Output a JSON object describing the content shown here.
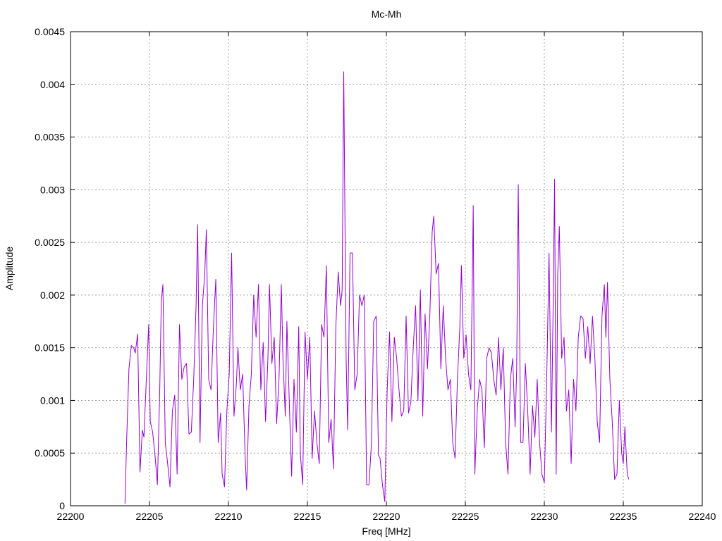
{
  "chart_data": {
    "type": "line",
    "title": "Mc-Mh",
    "xlabel": "Freq [MHz]",
    "ylabel": "Amplitude",
    "xlim": [
      22200,
      22240
    ],
    "ylim": [
      0,
      0.0045
    ],
    "grid": true,
    "x_ticks": [
      22200,
      22205,
      22210,
      22215,
      22220,
      22225,
      22230,
      22235,
      22240
    ],
    "y_ticks": [
      0,
      0.0005,
      0.001,
      0.0015,
      0.002,
      0.0025,
      0.003,
      0.0035,
      0.004,
      0.0045
    ],
    "x_tick_labels": [
      "22200",
      "22205",
      "22210",
      "22215",
      "22220",
      "22225",
      "22230",
      "22235",
      "22240"
    ],
    "y_tick_labels": [
      "0",
      "0.0005",
      "0.001",
      "0.0015",
      "0.002",
      "0.0025",
      "0.003",
      "0.0035",
      "0.004",
      "0.0045"
    ],
    "series": [
      {
        "color": "#9400d3",
        "points": [
          [
            22203.45,
            2e-05
          ],
          [
            22203.55,
            0.0006
          ],
          [
            22203.7,
            0.0013
          ],
          [
            22203.85,
            0.00152
          ],
          [
            22204.0,
            0.0015
          ],
          [
            22204.1,
            0.00145
          ],
          [
            22204.25,
            0.00163
          ],
          [
            22204.4,
            0.00032
          ],
          [
            22204.55,
            0.00072
          ],
          [
            22204.65,
            0.00065
          ],
          [
            22204.8,
            0.0012
          ],
          [
            22204.95,
            0.00172
          ],
          [
            22205.05,
            0.0008
          ],
          [
            22205.2,
            0.0007
          ],
          [
            22205.35,
            0.00048
          ],
          [
            22205.5,
            0.0002
          ],
          [
            22205.65,
            0.0011
          ],
          [
            22205.75,
            0.00195
          ],
          [
            22205.85,
            0.0021
          ],
          [
            22206.0,
            0.0006
          ],
          [
            22206.15,
            0.0004
          ],
          [
            22206.3,
            0.00018
          ],
          [
            22206.45,
            0.0009
          ],
          [
            22206.6,
            0.00105
          ],
          [
            22206.75,
            0.0003
          ],
          [
            22206.9,
            0.00172
          ],
          [
            22207.05,
            0.0012
          ],
          [
            22207.2,
            0.00132
          ],
          [
            22207.35,
            0.00135
          ],
          [
            22207.5,
            0.00068
          ],
          [
            22207.65,
            0.0007
          ],
          [
            22207.8,
            0.0012
          ],
          [
            22207.95,
            0.0019
          ],
          [
            22208.05,
            0.00267
          ],
          [
            22208.2,
            0.0006
          ],
          [
            22208.35,
            0.0019
          ],
          [
            22208.5,
            0.0022
          ],
          [
            22208.6,
            0.00262
          ],
          [
            22208.75,
            0.0012
          ],
          [
            22208.9,
            0.0011
          ],
          [
            22209.05,
            0.0017
          ],
          [
            22209.2,
            0.00215
          ],
          [
            22209.35,
            0.0006
          ],
          [
            22209.5,
            0.00088
          ],
          [
            22209.6,
            0.0003
          ],
          [
            22209.75,
            0.00018
          ],
          [
            22209.9,
            0.0009
          ],
          [
            22210.05,
            0.00125
          ],
          [
            22210.2,
            0.0024
          ],
          [
            22210.35,
            0.00085
          ],
          [
            22210.5,
            0.00115
          ],
          [
            22210.6,
            0.0015
          ],
          [
            22210.75,
            0.0011
          ],
          [
            22210.9,
            0.00125
          ],
          [
            22211.05,
            0.0005
          ],
          [
            22211.15,
            0.00015
          ],
          [
            22211.3,
            0.00095
          ],
          [
            22211.45,
            0.00125
          ],
          [
            22211.6,
            0.002
          ],
          [
            22211.75,
            0.0016
          ],
          [
            22211.9,
            0.0021
          ],
          [
            22212.05,
            0.0011
          ],
          [
            22212.2,
            0.00155
          ],
          [
            22212.35,
            0.0008
          ],
          [
            22212.5,
            0.0014
          ],
          [
            22212.6,
            0.0021
          ],
          [
            22212.75,
            0.00135
          ],
          [
            22212.9,
            0.0016
          ],
          [
            22213.05,
            0.00078
          ],
          [
            22213.2,
            0.0012
          ],
          [
            22213.35,
            0.0021
          ],
          [
            22213.45,
            0.0014
          ],
          [
            22213.6,
            0.00085
          ],
          [
            22213.7,
            0.00175
          ],
          [
            22213.85,
            0.001
          ],
          [
            22214.0,
            0.00028
          ],
          [
            22214.15,
            0.0012
          ],
          [
            22214.3,
            0.0007
          ],
          [
            22214.45,
            0.0017
          ],
          [
            22214.55,
            0.0005
          ],
          [
            22214.7,
            0.0002
          ],
          [
            22214.85,
            0.00165
          ],
          [
            22215.0,
            0.0012
          ],
          [
            22215.15,
            0.0016
          ],
          [
            22215.3,
            0.00045
          ],
          [
            22215.45,
            0.0009
          ],
          [
            22215.6,
            0.0006
          ],
          [
            22215.75,
            0.0004
          ],
          [
            22215.9,
            0.00172
          ],
          [
            22216.05,
            0.0016
          ],
          [
            22216.2,
            0.00228
          ],
          [
            22216.35,
            0.0006
          ],
          [
            22216.5,
            0.00082
          ],
          [
            22216.65,
            0.00035
          ],
          [
            22216.8,
            0.0017
          ],
          [
            22216.95,
            0.00222
          ],
          [
            22217.1,
            0.0019
          ],
          [
            22217.2,
            0.00205
          ],
          [
            22217.3,
            0.00412
          ],
          [
            22217.45,
            0.0014
          ],
          [
            22217.55,
            0.00072
          ],
          [
            22217.7,
            0.0024
          ],
          [
            22217.85,
            0.0024
          ],
          [
            22218.0,
            0.0011
          ],
          [
            22218.15,
            0.00125
          ],
          [
            22218.3,
            0.002
          ],
          [
            22218.45,
            0.0019
          ],
          [
            22218.6,
            0.002
          ],
          [
            22218.75,
            0.0002
          ],
          [
            22218.9,
            0.0002
          ],
          [
            22219.05,
            0.00058
          ],
          [
            22219.2,
            0.00175
          ],
          [
            22219.35,
            0.0018
          ],
          [
            22219.5,
            0.00048
          ],
          [
            22219.6,
            0.00045
          ],
          [
            22219.75,
            0.0002
          ],
          [
            22219.9,
            4e-05
          ],
          [
            22220.05,
            0.0011
          ],
          [
            22220.2,
            0.00165
          ],
          [
            22220.35,
            0.0008
          ],
          [
            22220.5,
            0.0016
          ],
          [
            22220.65,
            0.0014
          ],
          [
            22220.8,
            0.0011
          ],
          [
            22220.95,
            0.00085
          ],
          [
            22221.1,
            0.0009
          ],
          [
            22221.25,
            0.0018
          ],
          [
            22221.4,
            0.00088
          ],
          [
            22221.55,
            0.00098
          ],
          [
            22221.7,
            0.0015
          ],
          [
            22221.85,
            0.0019
          ],
          [
            22222.0,
            0.001
          ],
          [
            22222.15,
            0.00205
          ],
          [
            22222.3,
            0.00085
          ],
          [
            22222.45,
            0.00182
          ],
          [
            22222.6,
            0.0013
          ],
          [
            22222.75,
            0.0018
          ],
          [
            22222.9,
            0.0026
          ],
          [
            22223.0,
            0.00275
          ],
          [
            22223.15,
            0.0022
          ],
          [
            22223.3,
            0.0023
          ],
          [
            22223.45,
            0.0013
          ],
          [
            22223.6,
            0.0019
          ],
          [
            22223.75,
            0.0014
          ],
          [
            22223.9,
            0.0011
          ],
          [
            22224.05,
            0.0012
          ],
          [
            22224.2,
            0.0006
          ],
          [
            22224.35,
            0.00045
          ],
          [
            22224.5,
            0.0012
          ],
          [
            22224.65,
            0.0017
          ],
          [
            22224.75,
            0.00228
          ],
          [
            22224.9,
            0.0014
          ],
          [
            22225.05,
            0.00162
          ],
          [
            22225.2,
            0.00125
          ],
          [
            22225.35,
            0.0011
          ],
          [
            22225.5,
            0.00285
          ],
          [
            22225.6,
            0.0003
          ],
          [
            22225.75,
            0.0009
          ],
          [
            22225.9,
            0.0012
          ],
          [
            22226.05,
            0.0011
          ],
          [
            22226.2,
            0.00055
          ],
          [
            22226.35,
            0.0014
          ],
          [
            22226.5,
            0.0015
          ],
          [
            22226.65,
            0.00145
          ],
          [
            22226.8,
            0.0012
          ],
          [
            22226.95,
            0.00105
          ],
          [
            22227.1,
            0.0016
          ],
          [
            22227.25,
            0.0011
          ],
          [
            22227.4,
            0.0015
          ],
          [
            22227.55,
            0.0006
          ],
          [
            22227.7,
            0.0003
          ],
          [
            22227.85,
            0.0012
          ],
          [
            22228.0,
            0.0014
          ],
          [
            22228.15,
            0.00075
          ],
          [
            22228.25,
            0.0013
          ],
          [
            22228.35,
            0.00305
          ],
          [
            22228.5,
            0.0006
          ],
          [
            22228.65,
            0.0006
          ],
          [
            22228.8,
            0.00135
          ],
          [
            22228.95,
            0.0009
          ],
          [
            22229.1,
            0.0003
          ],
          [
            22229.25,
            0.00095
          ],
          [
            22229.4,
            0.00065
          ],
          [
            22229.55,
            0.0012
          ],
          [
            22229.7,
            0.0006
          ],
          [
            22229.85,
            0.0003
          ],
          [
            22230.0,
            0.00022
          ],
          [
            22230.15,
            0.0012
          ],
          [
            22230.3,
            0.0024
          ],
          [
            22230.45,
            0.0007
          ],
          [
            22230.55,
            0.0018
          ],
          [
            22230.65,
            0.0031
          ],
          [
            22230.75,
            0.0003
          ],
          [
            22230.85,
            0.0022
          ],
          [
            22230.95,
            0.00265
          ],
          [
            22231.1,
            0.0014
          ],
          [
            22231.25,
            0.0016
          ],
          [
            22231.4,
            0.0009
          ],
          [
            22231.55,
            0.0011
          ],
          [
            22231.7,
            0.0004
          ],
          [
            22231.85,
            0.0012
          ],
          [
            22232.0,
            0.0009
          ],
          [
            22232.15,
            0.0016
          ],
          [
            22232.3,
            0.0018
          ],
          [
            22232.45,
            0.00178
          ],
          [
            22232.6,
            0.0014
          ],
          [
            22232.75,
            0.0017
          ],
          [
            22232.9,
            0.00135
          ],
          [
            22233.05,
            0.0018
          ],
          [
            22233.2,
            0.0014
          ],
          [
            22233.35,
            0.0008
          ],
          [
            22233.5,
            0.0006
          ],
          [
            22233.65,
            0.0018
          ],
          [
            22233.8,
            0.0021
          ],
          [
            22233.9,
            0.0016
          ],
          [
            22234.0,
            0.00212
          ],
          [
            22234.15,
            0.0012
          ],
          [
            22234.3,
            0.0008
          ],
          [
            22234.45,
            0.00025
          ],
          [
            22234.6,
            0.0003
          ],
          [
            22234.75,
            0.001
          ],
          [
            22234.9,
            0.0005
          ],
          [
            22235.0,
            0.0004
          ],
          [
            22235.1,
            0.00075
          ],
          [
            22235.25,
            0.0003
          ],
          [
            22235.35,
            0.00025
          ]
        ]
      }
    ]
  }
}
